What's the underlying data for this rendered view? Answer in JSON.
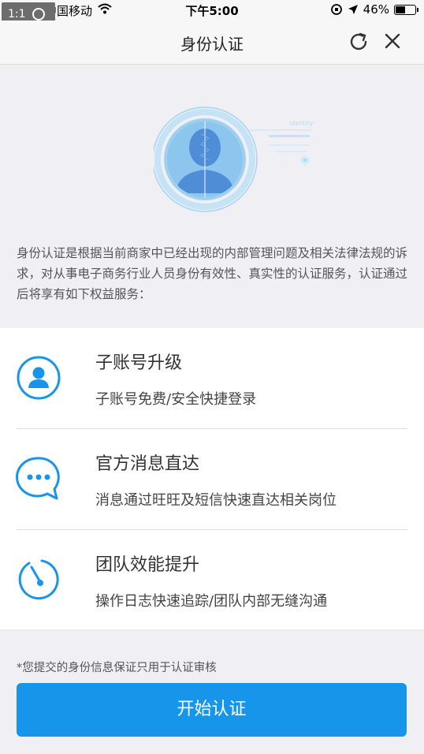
{
  "status_bar": {
    "zoom": "1:1",
    "carrier": "中国移动",
    "time": "下午5:00",
    "battery": "46%",
    "battery_level": 0.46
  },
  "nav": {
    "title": "身份认证",
    "refresh_icon": "refresh-icon",
    "close_icon": "close-icon"
  },
  "hero": {
    "illustration_label": "identity",
    "intro": "身份认证是根据当前商家中已经出现的内部管理问题及相关法律法规的诉求，对从事电子商务行业人员身份有效性、真实性的认证服务，认证通过后将享有如下权益服务："
  },
  "features": [
    {
      "icon": "user-icon",
      "title": "子账号升级",
      "desc": "子账号免费/安全快捷登录"
    },
    {
      "icon": "chat-bubble-icon",
      "title": "官方消息直达",
      "desc": "消息通过旺旺及短信快速直达相关岗位"
    },
    {
      "icon": "timer-icon",
      "title": "团队效能提升",
      "desc": "操作日志快速追踪/团队内部无缝沟通"
    }
  ],
  "footer": {
    "note": "*您提交的身份信息保证只用于认证审核",
    "button": "开始认证"
  },
  "colors": {
    "accent": "#1795ea",
    "background": "#efeff4"
  }
}
